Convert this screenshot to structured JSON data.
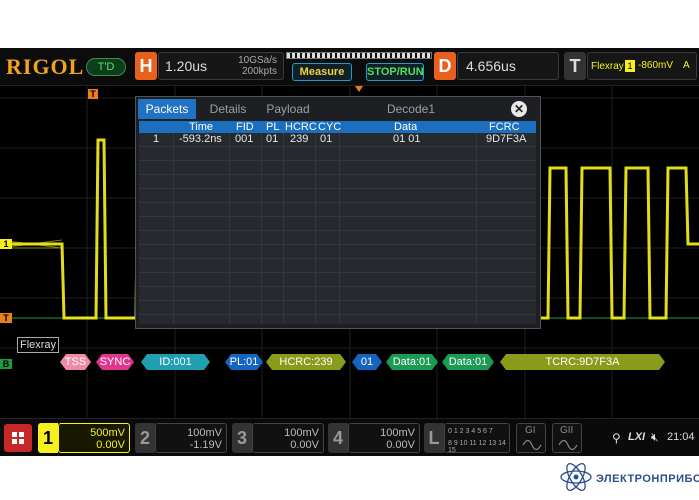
{
  "brand": {
    "logo": "RIGOL",
    "mode": "T'D"
  },
  "horizontal": {
    "letter": "H",
    "timebase": "1.20us",
    "sample_rate": "10GSa/s",
    "memory": "200kpts"
  },
  "buttons": {
    "measure": "Measure",
    "stop_run": "STOP/RUN"
  },
  "delay": {
    "letter": "D",
    "value": "4.656us"
  },
  "trigger": {
    "letter": "T",
    "source": "Flexray",
    "channel": "1",
    "level": "-860mV",
    "mode": "A"
  },
  "dialog": {
    "tabs": [
      "Packets",
      "Details",
      "Payload"
    ],
    "decoder": "Decode1",
    "close": "✕",
    "columns": [
      "Time",
      "FID",
      "PL",
      "HCRC",
      "CYC",
      "Data",
      "FCRC"
    ],
    "rows": [
      {
        "index": "1",
        "time": "-593.2ns",
        "fid": "001",
        "pl": "01",
        "hcrc": "239",
        "cyc": "01",
        "data": "01 01",
        "fcrc": "9D7F3A"
      }
    ]
  },
  "bus_label": "Flexray",
  "bus_segments": [
    {
      "label": "TSS",
      "color": "#f08aa6"
    },
    {
      "label": "SYNC",
      "color": "#e0358f"
    },
    {
      "label": "ID:001",
      "color": "#1f9fb0"
    },
    {
      "label": "PL:01",
      "color": "#1565c0"
    },
    {
      "label": "HCRC:239",
      "color": "#8a9a1a"
    },
    {
      "label": "01",
      "color": "#1565c0"
    },
    {
      "label": "Data:01",
      "color": "#1a9a52"
    },
    {
      "label": "Data:01",
      "color": "#1a9a52"
    },
    {
      "label": "TCRC:9D7F3A",
      "color": "#8a9a1a"
    }
  ],
  "markers": {
    "trigger_top": "T",
    "channel_left": "1",
    "trigger_level": "T",
    "bus_left": "B"
  },
  "channels": [
    {
      "num": "1",
      "scale": "500mV",
      "offset": "0.00V",
      "active": true
    },
    {
      "num": "2",
      "scale": "100mV",
      "offset": "-1.19V",
      "active": false
    },
    {
      "num": "3",
      "scale": "100mV",
      "offset": "0.00V",
      "active": false
    },
    {
      "num": "4",
      "scale": "100mV",
      "offset": "0.00V",
      "active": false
    }
  ],
  "logic": {
    "letter": "L",
    "row1": "0 1 2 3 4 5 6 7",
    "row2": "8 9 10 11 12 13 14 15"
  },
  "generators": [
    "GI",
    "GII"
  ],
  "status": {
    "lxi": "LXI",
    "time": "21:04"
  },
  "watermark": "ЭЛЕКТРОНПРИБОР",
  "colors": {
    "ch1": "#f5f01e",
    "accent": "#f3a31f",
    "header": "#1c6fbf"
  }
}
